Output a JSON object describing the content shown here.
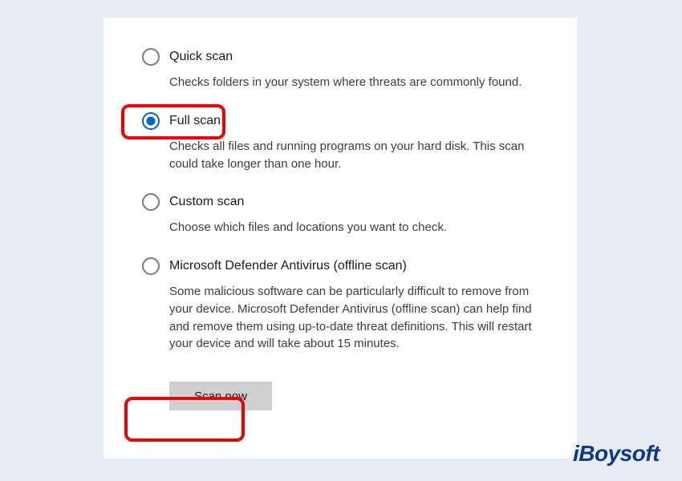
{
  "options": [
    {
      "label": "Quick scan",
      "desc": "Checks folders in your system where threats are commonly found.",
      "selected": false
    },
    {
      "label": "Full scan",
      "desc": "Checks all files and running programs on your hard disk. This scan could take longer than one hour.",
      "selected": true
    },
    {
      "label": "Custom scan",
      "desc": "Choose which files and locations you want to check.",
      "selected": false
    },
    {
      "label": "Microsoft Defender Antivirus (offline scan)",
      "desc": "Some malicious software can be particularly difficult to remove from your device. Microsoft Defender Antivirus (offline scan) can help find and remove them using up-to-date threat definitions. This will restart your device and will take about 15 minutes.",
      "selected": false
    }
  ],
  "scan_button": "Scan now",
  "watermark": "iBoysoft"
}
